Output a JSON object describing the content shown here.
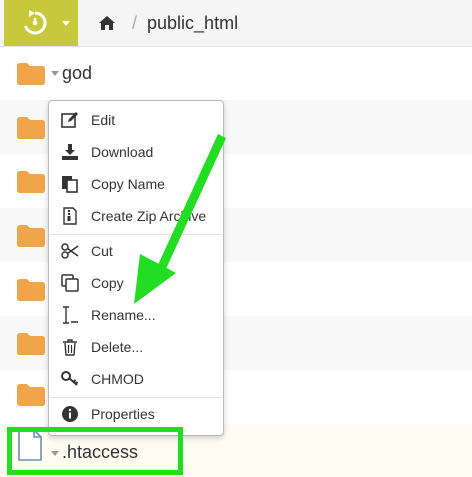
{
  "toolbar": {
    "history_icon": "history-icon",
    "home_icon": "home-icon",
    "separator": "/",
    "path": "public_html"
  },
  "rows": [
    {
      "label": "god",
      "icon": "folder-icon"
    },
    {
      "label": "",
      "icon": "folder-icon"
    },
    {
      "label": "",
      "icon": "folder-icon"
    },
    {
      "label": "",
      "icon": "folder-icon"
    },
    {
      "label": "",
      "icon": "folder-icon"
    },
    {
      "label": "",
      "icon": "folder-icon"
    },
    {
      "label": "",
      "icon": "folder-icon"
    },
    {
      "label": ".htaccess",
      "icon": "file-icon"
    }
  ],
  "context_menu": {
    "items": [
      {
        "label": "Edit",
        "icon": "edit-icon"
      },
      {
        "label": "Download",
        "icon": "download-icon"
      },
      {
        "label": "Copy Name",
        "icon": "copy-name-icon"
      },
      {
        "label": "Create Zip Archive",
        "icon": "zip-icon"
      },
      {
        "label": "Cut",
        "icon": "scissors-icon"
      },
      {
        "label": "Copy",
        "icon": "copy-icon"
      },
      {
        "label": "Rename...",
        "icon": "text-cursor-icon"
      },
      {
        "label": "Delete...",
        "icon": "trash-icon"
      },
      {
        "label": "CHMOD",
        "icon": "key-icon"
      },
      {
        "label": "Properties",
        "icon": "info-icon"
      }
    ]
  },
  "colors": {
    "history_button": "#c8c83c",
    "folder": "#f0a54a",
    "annotation": "#22dd22"
  }
}
